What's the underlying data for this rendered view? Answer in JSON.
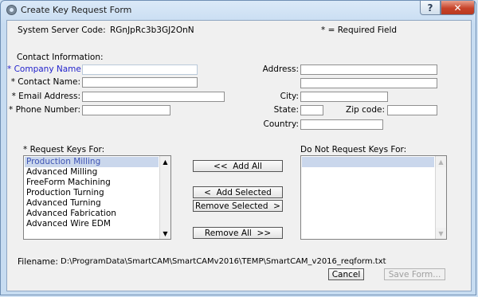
{
  "window": {
    "title": "Create Key Request Form",
    "help_glyph": "?",
    "close_glyph": "✕"
  },
  "header": {
    "server_code_label": "System Server Code:",
    "server_code_value": "RGnJpRc3b3GJ2OnN",
    "required_note": "* = Required Field"
  },
  "contact": {
    "section_label": "Contact Information:",
    "company_label": "* Company Name:",
    "company_value": "",
    "contact_label": "* Contact Name:",
    "contact_value": "",
    "email_label": "* Email Address:",
    "email_value": "",
    "phone_label": "* Phone Number:",
    "phone_value": ""
  },
  "address": {
    "address_label": "Address:",
    "address_line1": "",
    "address_line2": "",
    "city_label": "City:",
    "city_value": "",
    "state_label": "State:",
    "state_value": "",
    "zip_label": "Zip code:",
    "zip_value": "",
    "country_label": "Country:",
    "country_value": ""
  },
  "request_keys": {
    "label": "* Request Keys For:",
    "items": [
      "Production Milling",
      "Advanced Milling",
      "FreeForm Machining",
      "Production Turning",
      "Advanced Turning",
      "Advanced Fabrication",
      "Advanced Wire EDM"
    ],
    "selected_index": 0
  },
  "do_not_request": {
    "label": "Do Not Request Keys For:",
    "items": []
  },
  "buttons": {
    "add_all": "<<  Add All",
    "add_selected": "<  Add Selected",
    "remove_selected": "Remove Selected  >",
    "remove_all": "Remove All  >>",
    "cancel": "Cancel",
    "save": "Save Form..."
  },
  "scroll_icons": {
    "up": "up-arrow-icon",
    "down": "down-arrow-icon",
    "up_glyph": "▲",
    "down_glyph": "▼"
  },
  "footer": {
    "filename_label": "Filename:",
    "filename_value": "D:\\ProgramData\\SmartCAM\\SmartCAMv2016\\TEMP\\SmartCAM_v2016_reqform.txt"
  },
  "colors": {
    "required_highlight": "#2323cc",
    "selection": "#cad7ec",
    "close_button": "#c7432a"
  }
}
